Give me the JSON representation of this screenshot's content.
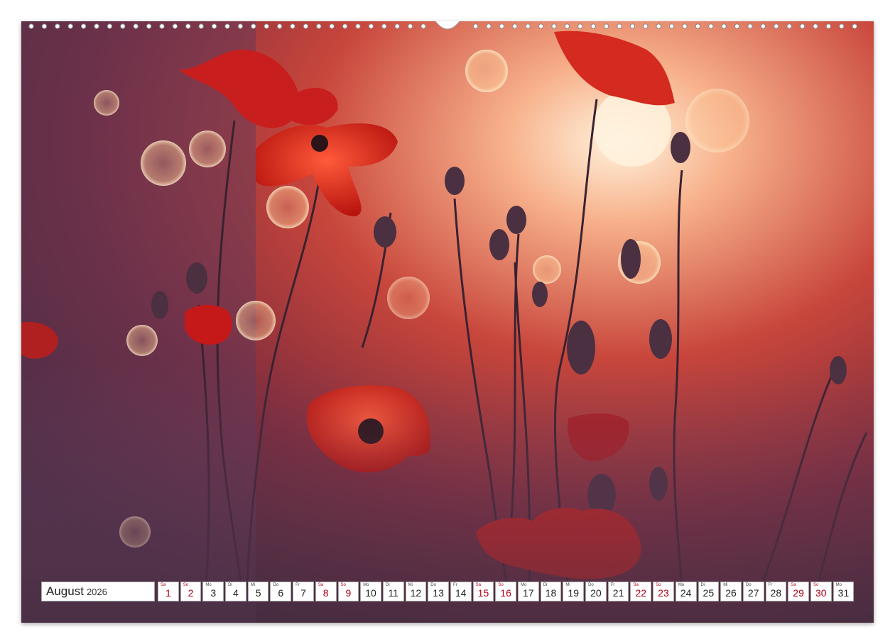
{
  "calendar": {
    "month": "August",
    "year": "2026",
    "days": [
      {
        "n": "1",
        "d": "Sa",
        "we": true
      },
      {
        "n": "2",
        "d": "So",
        "we": true
      },
      {
        "n": "3",
        "d": "Mo",
        "we": false
      },
      {
        "n": "4",
        "d": "Di",
        "we": false
      },
      {
        "n": "5",
        "d": "Mi",
        "we": false
      },
      {
        "n": "6",
        "d": "Do",
        "we": false
      },
      {
        "n": "7",
        "d": "Fr",
        "we": false
      },
      {
        "n": "8",
        "d": "Sa",
        "we": true
      },
      {
        "n": "9",
        "d": "So",
        "we": true
      },
      {
        "n": "10",
        "d": "Mo",
        "we": false
      },
      {
        "n": "11",
        "d": "Di",
        "we": false
      },
      {
        "n": "12",
        "d": "Mi",
        "we": false
      },
      {
        "n": "13",
        "d": "Do",
        "we": false
      },
      {
        "n": "14",
        "d": "Fr",
        "we": false
      },
      {
        "n": "15",
        "d": "Sa",
        "we": true
      },
      {
        "n": "16",
        "d": "So",
        "we": true
      },
      {
        "n": "17",
        "d": "Mo",
        "we": false
      },
      {
        "n": "18",
        "d": "Di",
        "we": false
      },
      {
        "n": "19",
        "d": "Mi",
        "we": false
      },
      {
        "n": "20",
        "d": "Do",
        "we": false
      },
      {
        "n": "21",
        "d": "Fr",
        "we": false
      },
      {
        "n": "22",
        "d": "Sa",
        "we": true
      },
      {
        "n": "23",
        "d": "So",
        "we": true
      },
      {
        "n": "24",
        "d": "Mo",
        "we": false
      },
      {
        "n": "25",
        "d": "Di",
        "we": false
      },
      {
        "n": "26",
        "d": "Mi",
        "we": false
      },
      {
        "n": "27",
        "d": "Do",
        "we": false
      },
      {
        "n": "28",
        "d": "Fr",
        "we": false
      },
      {
        "n": "29",
        "d": "Sa",
        "we": true
      },
      {
        "n": "30",
        "d": "So",
        "we": true
      },
      {
        "n": "31",
        "d": "Mo",
        "we": false
      }
    ]
  },
  "colors": {
    "weekend": "#b00018",
    "poppy": "#d8221c",
    "glow": "#ffe6c8"
  },
  "icons": {
    "binding": "wire-binding-icon",
    "hanger": "hanger-hook-icon"
  }
}
